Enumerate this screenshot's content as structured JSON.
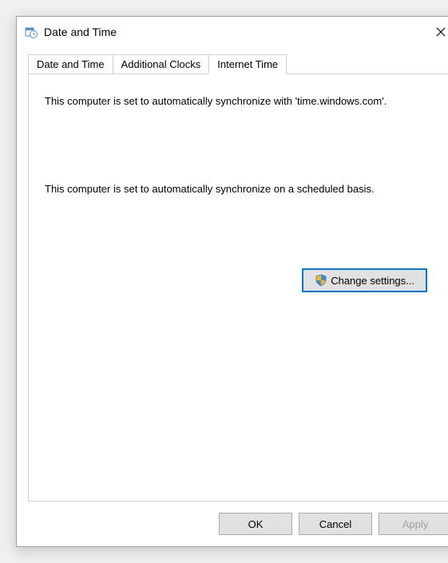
{
  "window": {
    "title": "Date and Time"
  },
  "tabs": {
    "date_time": "Date and Time",
    "additional_clocks": "Additional Clocks",
    "internet_time": "Internet Time"
  },
  "panel": {
    "sync_info": "This computer is set to automatically synchronize with 'time.windows.com'.",
    "schedule_info": "This computer is set to automatically synchronize on a scheduled basis.",
    "change_settings": "Change settings..."
  },
  "buttons": {
    "ok": "OK",
    "cancel": "Cancel",
    "apply": "Apply"
  }
}
